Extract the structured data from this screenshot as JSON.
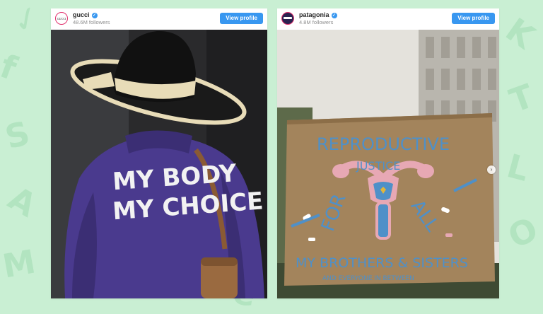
{
  "background": {
    "color": "#c9efd3",
    "letter_color": "#b2e4c0"
  },
  "posts": [
    {
      "username": "gucci",
      "followers": "48.6M followers",
      "verified": true,
      "button_label": "View profile",
      "avatar_text": "GUCCI",
      "photo_text_line1": "MY BODY",
      "photo_text_line2": "MY CHOICE",
      "photo_description_icon": "runway-model-hat-icon"
    },
    {
      "username": "patagonia",
      "followers": "4.8M followers",
      "verified": true,
      "button_label": "View profile",
      "photo_sign_title": "REPRODUCTIVE",
      "photo_sign_title2": "JUSTICE",
      "photo_sign_mid_left": "FOR",
      "photo_sign_mid_right": "ALL",
      "photo_sign_bottom": "MY BROTHERS & SISTERS",
      "photo_sign_bottom2": "AND EVERYONE IN BETWEEN",
      "next_icon": "chevron-right-icon"
    }
  ],
  "accent_color": "#3897f0"
}
